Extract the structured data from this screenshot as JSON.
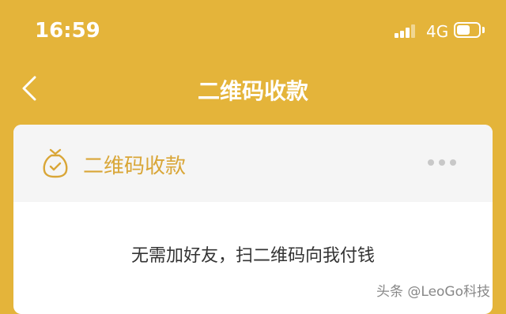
{
  "status_bar": {
    "time": "16:59",
    "network": "4G",
    "signal_bars_visible": 3,
    "battery_level": 0.6
  },
  "nav": {
    "title": "二维码收款",
    "back_icon": "chevron-left-icon"
  },
  "card": {
    "title": "二维码收款",
    "title_icon": "money-bag-icon",
    "more_icon": "more-dots-icon",
    "instruction": "无需加好友，扫二维码向我付钱"
  },
  "watermark": "头条 @LeoGo科技",
  "colors": {
    "background": "#E4B43A",
    "accent": "#D9A637",
    "card_header": "#F5F5F5"
  }
}
